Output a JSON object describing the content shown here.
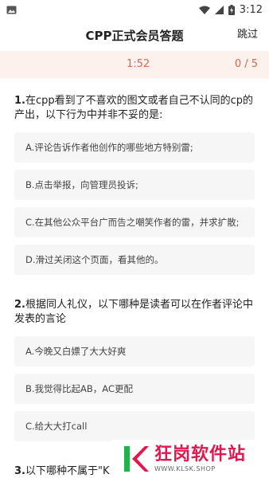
{
  "status_bar": {
    "time": "3:12"
  },
  "header": {
    "title": "CPP正式会员答题",
    "skip_label": "跳过"
  },
  "progress": {
    "timer": "1:52",
    "counter": "0 / 5"
  },
  "questions": [
    {
      "number": "1.",
      "text": "在cpp看到了不喜欢的图文或者自己不认同的cp的产出，以下行为中并非不妥的是:",
      "options": [
        "A.评论告诉作者他创作的哪些地方特别雷;",
        "B.点击举报，向管理员投诉;",
        "C.在其他公众平台广而告之嘲笑作者的雷，并求扩散;",
        "D.滑过关闭这个页面，看其他的。"
      ]
    },
    {
      "number": "2.",
      "text": "根据同人礼仪，以下哪种是读者可以在作者评论中发表的言论",
      "options": [
        "A.今晚又白嫖了大大好爽",
        "B.我觉得比起AB，AC更配",
        "C.给大大打call"
      ]
    },
    {
      "number": "3.",
      "text": "以下哪种不属于\"K",
      "options": []
    }
  ],
  "watermark": {
    "name": "狂岗软件站",
    "url": "WWW.KLSK.SHOP"
  },
  "colors": {
    "accent": "#e0664a",
    "strip_bg": "#fdf1ee",
    "option_bg": "#f6f6f6",
    "watermark_red": "#e2174d",
    "watermark_green": "#22b14c"
  }
}
